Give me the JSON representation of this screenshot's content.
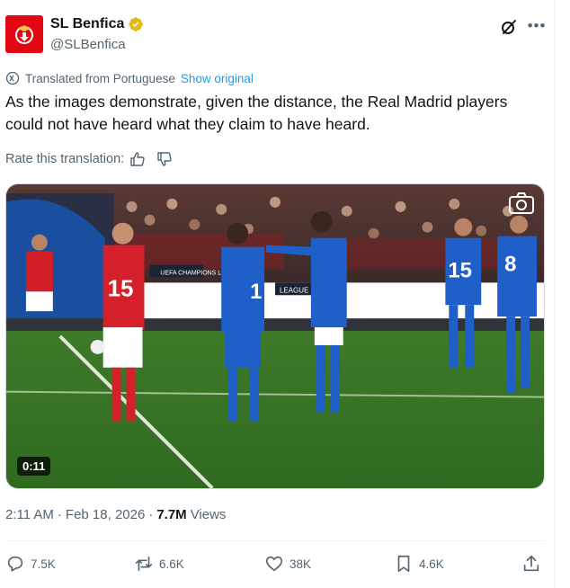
{
  "tweet": {
    "author_name": "SL Benfica",
    "author_handle": "@SLBenfica",
    "translated_label": "Translated from Portuguese",
    "show_original": "Show original",
    "text": "As the images demonstrate, given the distance, the Real Madrid players could not have heard what they claim to have heard.",
    "rate_label": "Rate this translation:",
    "video_duration": "0:11",
    "time": "2:11 AM",
    "date": "Feb 18, 2026",
    "views_count": "7.7M",
    "views_label": "Views",
    "separator": "·"
  },
  "scene_text": {
    "left_player_number": "15",
    "center_player_number": "1",
    "right_player_a": "15",
    "right_player_b": "8",
    "board_a": "UEFA CHAMPIONS LEAGUE",
    "board_b": "LEAGUE"
  },
  "actions": {
    "replies": "7.5K",
    "reposts": "6.6K",
    "likes": "38K",
    "bookmarks": "4.6K"
  },
  "colors": {
    "benfica_red": "#e30613",
    "link_blue": "#1d9bf0",
    "verified_gold": "#e2b719",
    "secondary_text": "#536471"
  },
  "icons": {
    "grok": "grok-icon",
    "more": "more-icon",
    "translate": "translate-icon",
    "thumbs_up": "thumbs-up-icon",
    "thumbs_down": "thumbs-down-icon",
    "camera": "camera-icon",
    "reply": "reply-icon",
    "repost": "repost-icon",
    "like": "heart-icon",
    "bookmark": "bookmark-icon",
    "share": "share-icon"
  }
}
